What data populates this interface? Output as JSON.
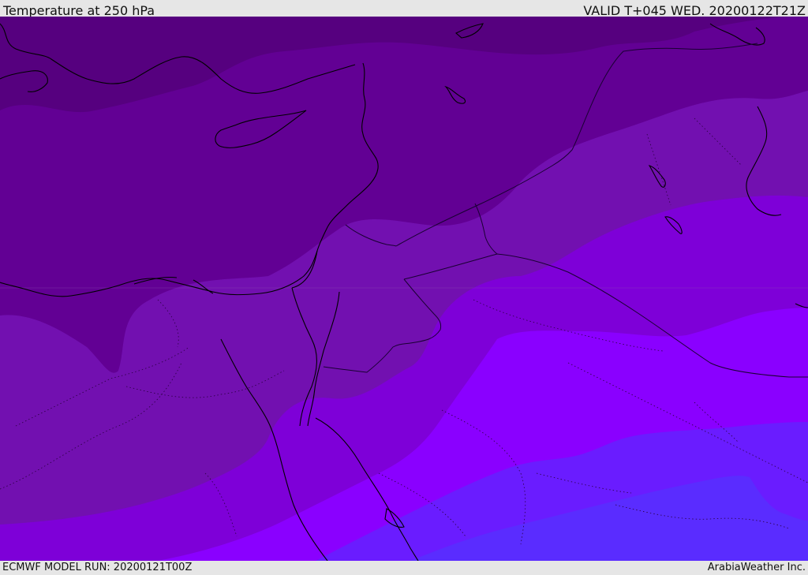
{
  "header": {
    "title": "Temperature at 250 hPa",
    "valid_time": "VALID T+045 WED. 20200122T21Z"
  },
  "footer": {
    "model_run": "ECMWF MODEL RUN: 20200121T00Z",
    "credit": "ArabiaWeather Inc."
  },
  "colors": {
    "band_1": "#56007f",
    "band_2": "#620094",
    "band_3": "#7210b0",
    "band_4": "#7e00d8",
    "band_5": "#8a00ff",
    "band_6": "#6a1cff",
    "band_7": "#5a2cff",
    "coast": "#000000",
    "border": "#1a0033"
  },
  "map": {
    "field": "Temperature",
    "level": "250 hPa",
    "region": "Eastern Mediterranean and Middle East"
  }
}
